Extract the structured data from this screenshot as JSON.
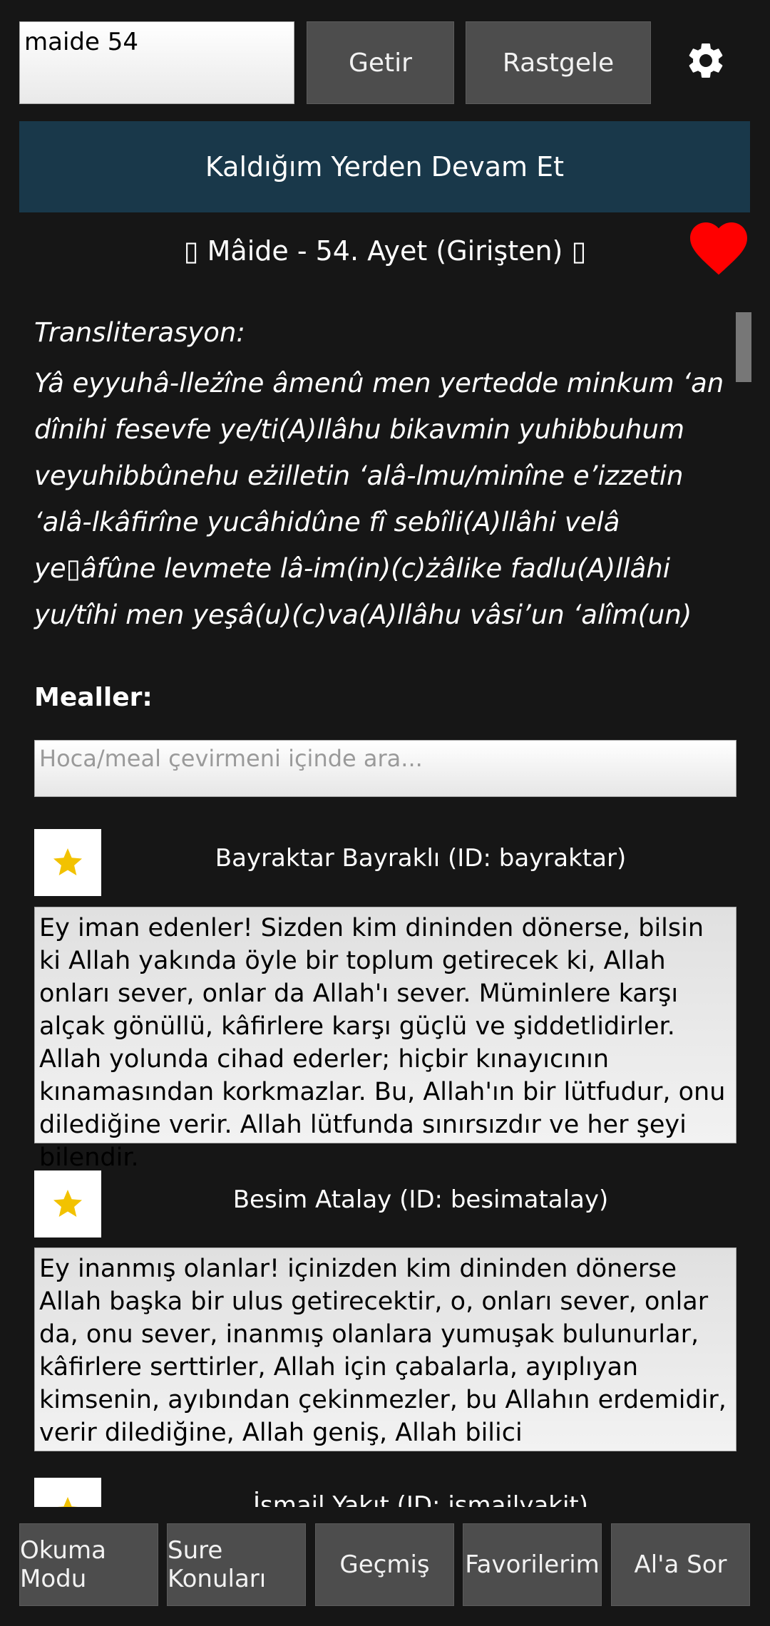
{
  "search": {
    "value": "maide 54"
  },
  "buttons": {
    "getir": "Getir",
    "rastgele": "Rastgele"
  },
  "continue_label": "Kaldığım Yerden Devam Et",
  "ayet_title": "▯ Mâide - 54. Ayet (Girişten) ▯",
  "transliteration": {
    "label": "Transliterasyon:",
    "text": "Yâ eyyuhâ-lleżîne âmenû men yertedde minkum ‘an dînihi fesevfe ye/ti(A)llâhu bikavmin yuhibbuhum veyuhibbûnehu eżilletin ‘alâ-lmu/minîne e’izzetin ‘alâ-lkâfirîne yucâhidûne fî sebîli(A)llâhi velâ ye▯âfûne levmete lâ-im(in)(c)żâlike fadlu(A)llâhi yu/tîhi men yeşâ(u)(c)va(A)llâhu vâsi’un ‘alîm(un)"
  },
  "mealler_label": "Mealler:",
  "meal_search_placeholder": "Hoca/meal çevirmeni içinde ara...",
  "meals": [
    {
      "translator": "Bayraktar Bayraklı (ID: bayraktar)",
      "text": "Ey iman edenler! Sizden kim dininden dönerse, bilsin ki Allah yakında öyle bir toplum getirecek ki, Allah onları sever, onlar da Allah'ı sever. Müminlere karşı alçak gönüllü, kâfirlere karşı güçlü ve şiddetlidirler. Allah yolunda cihad ederler; hiçbir kınayıcının kınamasından korkmazlar. Bu, Allah'ın bir lütfudur, onu dilediğine verir. Allah lütfunda sınırsızdır ve her şeyi bilendir."
    },
    {
      "translator": "Besim Atalay (ID: besimatalay)",
      "text": "Ey inanmış olanlar! içinizden kim dininden dönerse Allah başka bir ulus getirecektir, o, onları sever, onlar da, onu sever, inanmış olanlara yumuşak bulunurlar, kâfirlere serttirler, Allah için çabalarla, ayıplıyan kimsenin, ayıbından çekinmezler, bu Allahın erdemidir, verir dilediğine, Allah geniş, Allah bilici"
    },
    {
      "translator": "İsmail Yakıt (ID: ismailyakit)"
    }
  ],
  "bottom_nav": [
    "Okuma Modu",
    "Sure Konuları",
    "Geçmiş",
    "Favorilerim",
    "Al'a Sor"
  ],
  "colors": {
    "background": "#161616",
    "continue_bar": "#19384a",
    "button": "#4d4d4d",
    "heart": "#ff0000",
    "star": "#f2c200"
  }
}
